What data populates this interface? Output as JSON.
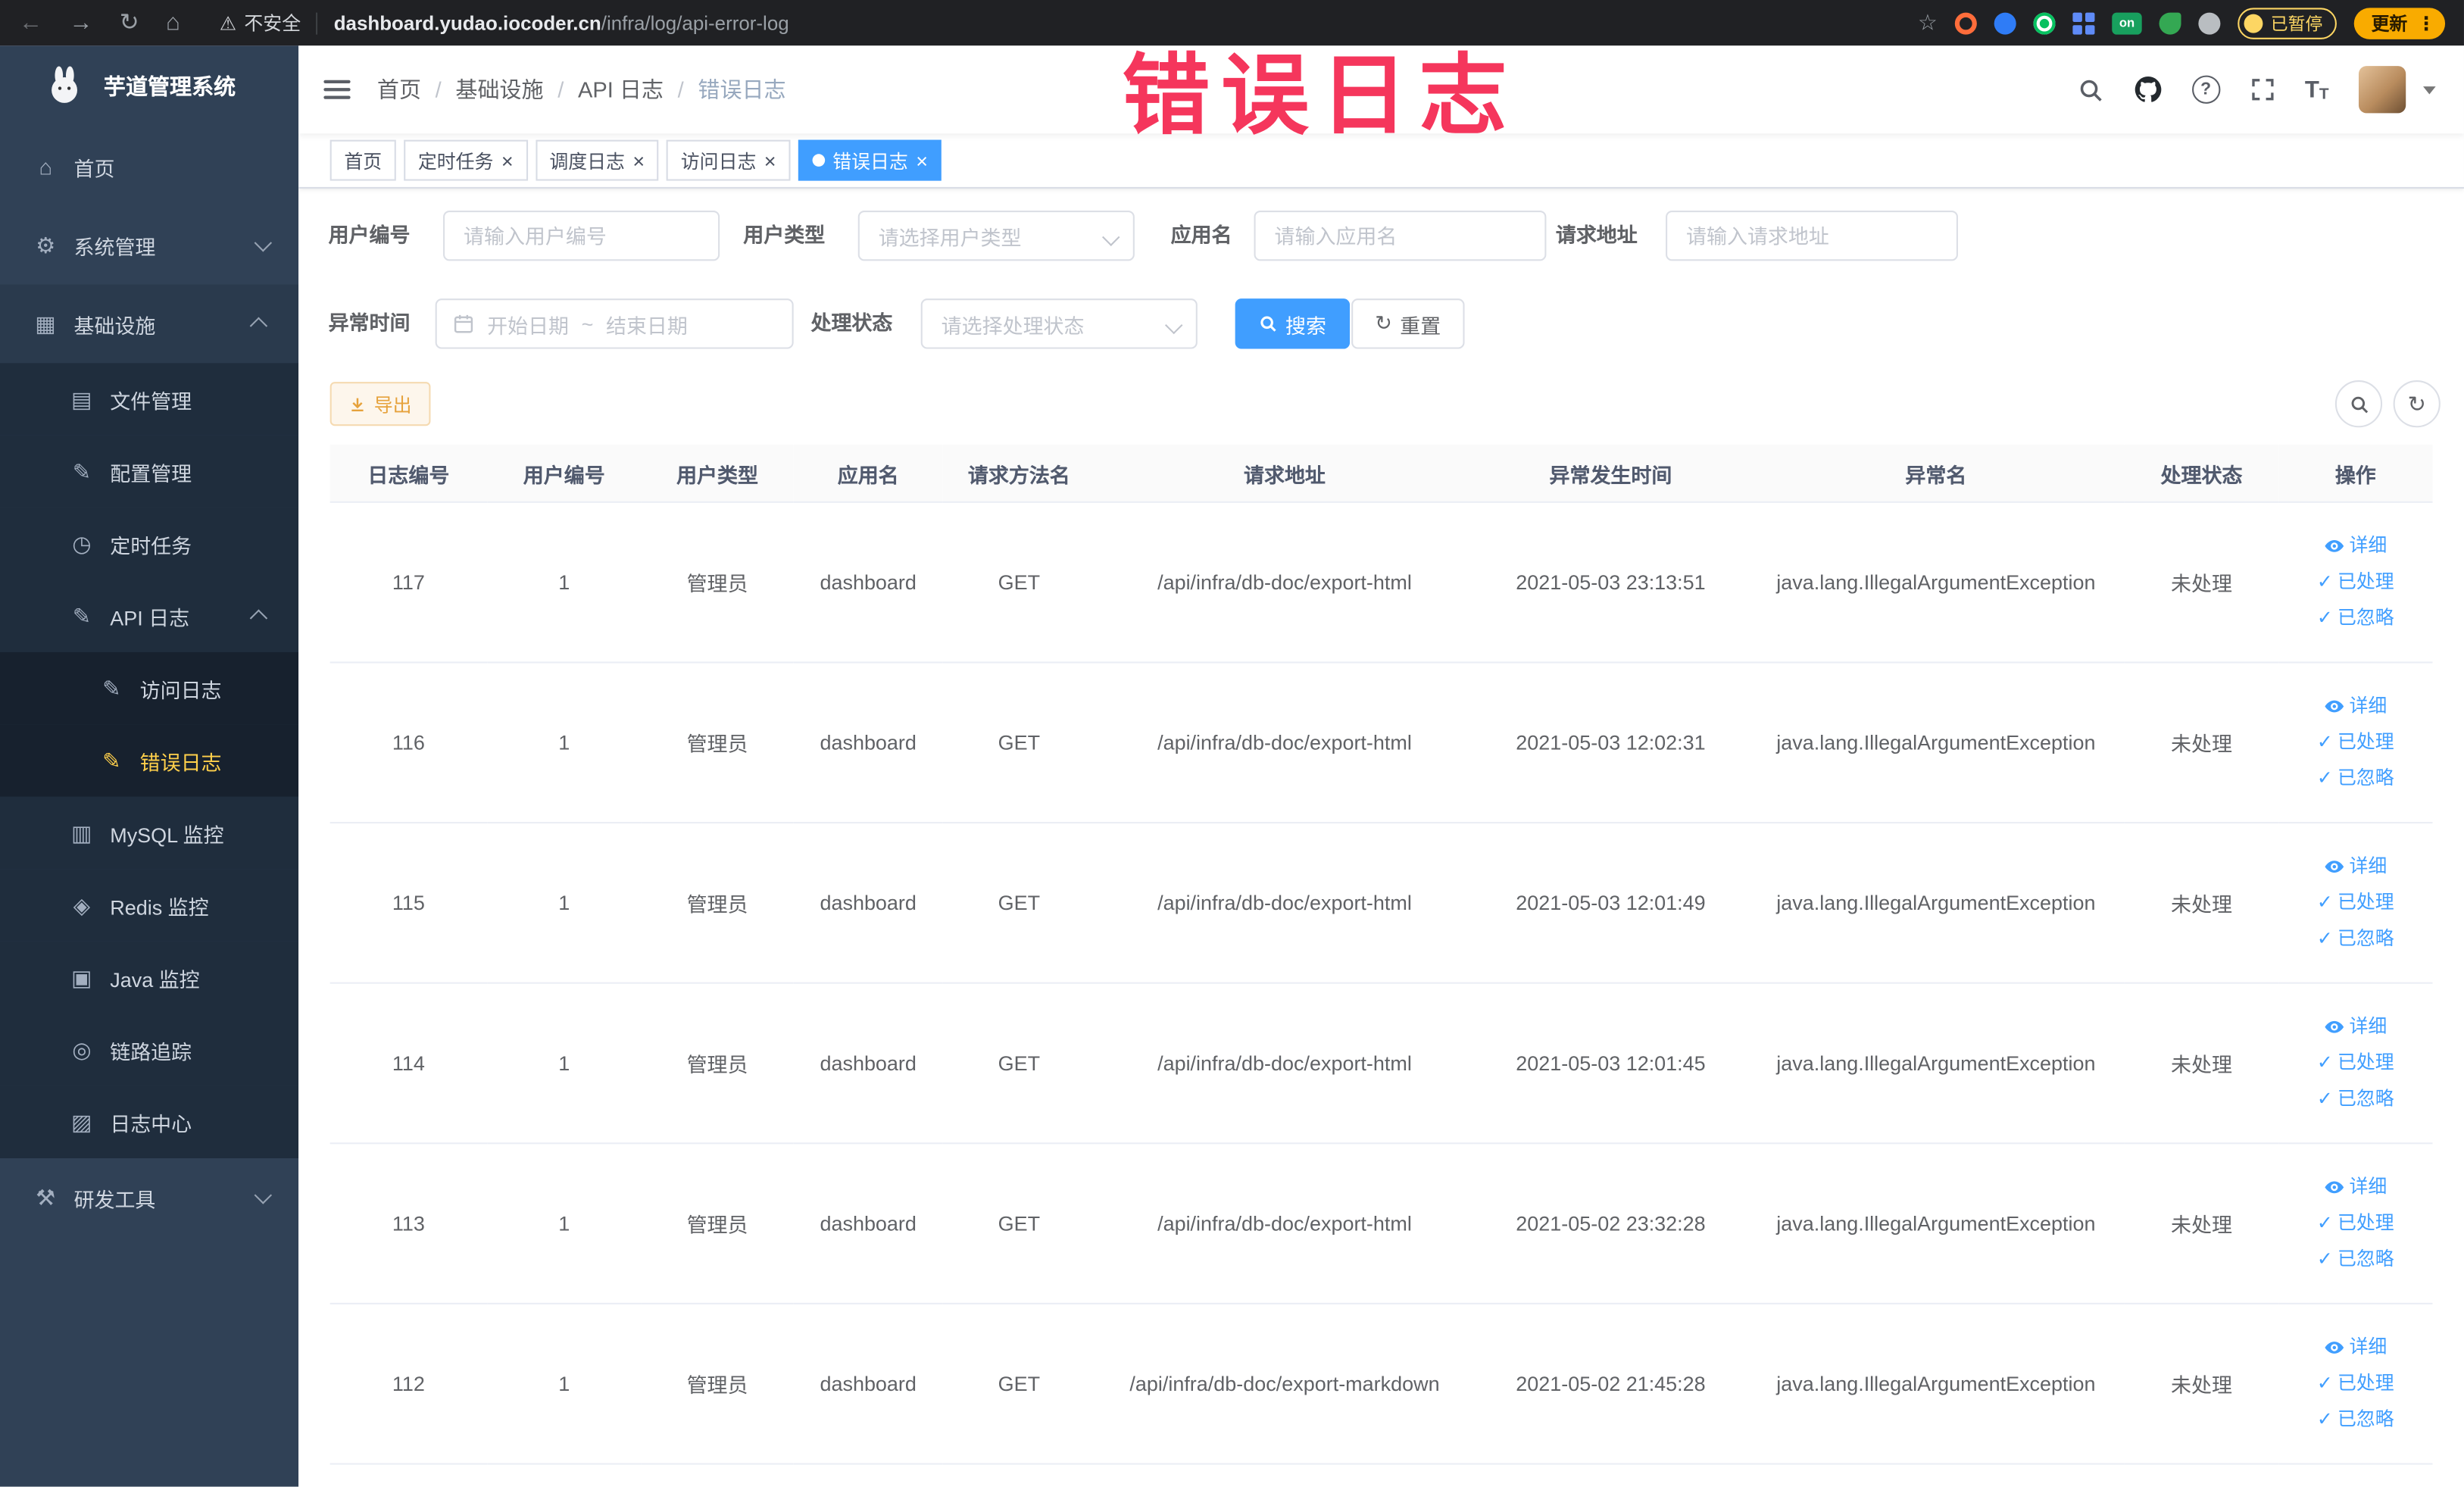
{
  "browser": {
    "security_label": "不安全",
    "url_domain": "dashboard.yudao.iocoder.cn",
    "url_path": "/infra/log/api-error-log",
    "extension_on_label": "on",
    "paused_badge_label": "已暂停",
    "update_button_label": "更新"
  },
  "sidebar": {
    "app_title": "芋道管理系统",
    "items": [
      {
        "label": "首页"
      },
      {
        "label": "系统管理"
      },
      {
        "label": "基础设施"
      },
      {
        "label": "文件管理"
      },
      {
        "label": "配置管理"
      },
      {
        "label": "定时任务"
      },
      {
        "label": "API 日志"
      },
      {
        "label": "访问日志"
      },
      {
        "label": "错误日志"
      },
      {
        "label": "MySQL 监控"
      },
      {
        "label": "Redis 监控"
      },
      {
        "label": "Java 监控"
      },
      {
        "label": "链路追踪"
      },
      {
        "label": "日志中心"
      },
      {
        "label": "研发工具"
      }
    ]
  },
  "header": {
    "breadcrumb": [
      "首页",
      "基础设施",
      "API 日志",
      "错误日志"
    ],
    "icons": {
      "help_glyph": "?",
      "font_glyph": "T"
    }
  },
  "watermark": "错误日志",
  "tags": [
    {
      "label": "首页"
    },
    {
      "label": "定时任务"
    },
    {
      "label": "调度日志"
    },
    {
      "label": "访问日志"
    },
    {
      "label": "错误日志"
    }
  ],
  "filters": {
    "user_id": {
      "label": "用户编号",
      "placeholder": "请输入用户编号"
    },
    "user_type": {
      "label": "用户类型",
      "placeholder": "请选择用户类型"
    },
    "app_name": {
      "label": "应用名",
      "placeholder": "请输入应用名"
    },
    "request_url": {
      "label": "请求地址",
      "placeholder": "请输入请求地址"
    },
    "exception_time": {
      "label": "异常时间",
      "start_placeholder": "开始日期",
      "separator": "~",
      "end_placeholder": "结束日期"
    },
    "process_status": {
      "label": "处理状态",
      "placeholder": "请选择处理状态"
    },
    "search_label": "搜索",
    "reset_label": "重置"
  },
  "toolbar": {
    "export_label": "导出"
  },
  "table": {
    "headers": [
      "日志编号",
      "用户编号",
      "用户类型",
      "应用名",
      "请求方法名",
      "请求地址",
      "异常发生时间",
      "异常名",
      "处理状态",
      "操作"
    ],
    "action_labels": {
      "detail": "详细",
      "processed": "已处理",
      "ignored": "已忽略"
    },
    "rows": [
      {
        "id": "117",
        "user_id": "1",
        "user_type": "管理员",
        "app": "dashboard",
        "method": "GET",
        "url": "/api/infra/db-doc/export-html",
        "time": "2021-05-03 23:13:51",
        "exception": "java.lang.IllegalArgumentException",
        "status": "未处理"
      },
      {
        "id": "116",
        "user_id": "1",
        "user_type": "管理员",
        "app": "dashboard",
        "method": "GET",
        "url": "/api/infra/db-doc/export-html",
        "time": "2021-05-03 12:02:31",
        "exception": "java.lang.IllegalArgumentException",
        "status": "未处理"
      },
      {
        "id": "115",
        "user_id": "1",
        "user_type": "管理员",
        "app": "dashboard",
        "method": "GET",
        "url": "/api/infra/db-doc/export-html",
        "time": "2021-05-03 12:01:49",
        "exception": "java.lang.IllegalArgumentException",
        "status": "未处理"
      },
      {
        "id": "114",
        "user_id": "1",
        "user_type": "管理员",
        "app": "dashboard",
        "method": "GET",
        "url": "/api/infra/db-doc/export-html",
        "time": "2021-05-03 12:01:45",
        "exception": "java.lang.IllegalArgumentException",
        "status": "未处理"
      },
      {
        "id": "113",
        "user_id": "1",
        "user_type": "管理员",
        "app": "dashboard",
        "method": "GET",
        "url": "/api/infra/db-doc/export-html",
        "time": "2021-05-02 23:32:28",
        "exception": "java.lang.IllegalArgumentException",
        "status": "未处理"
      },
      {
        "id": "112",
        "user_id": "1",
        "user_type": "管理员",
        "app": "dashboard",
        "method": "GET",
        "url": "/api/infra/db-doc/export-markdown",
        "time": "2021-05-02 21:45:28",
        "exception": "java.lang.IllegalArgumentException",
        "status": "未处理"
      }
    ]
  },
  "colors": {
    "primary": "#409eff",
    "sidebar_bg": "#304156",
    "active_menu_text": "#ffd04b",
    "watermark": "#f5365c",
    "warning": "#e6a23c"
  }
}
